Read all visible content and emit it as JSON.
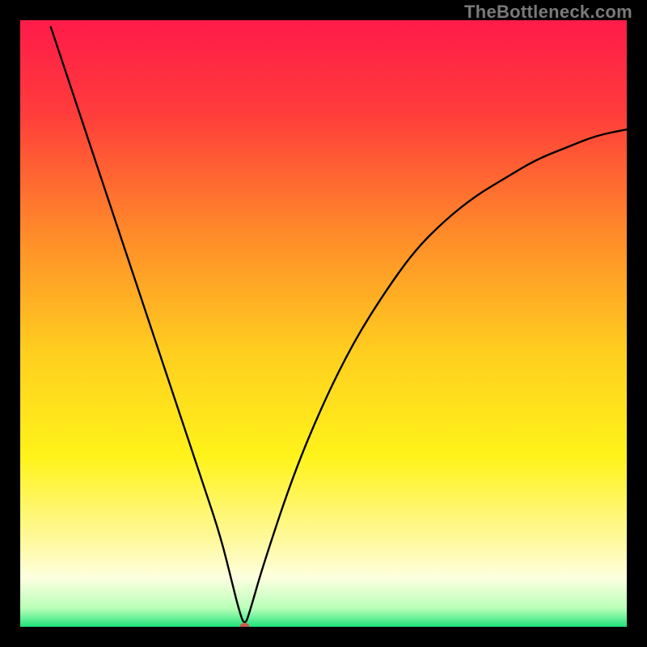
{
  "watermark": "TheBottleneck.com",
  "chart_data": {
    "type": "line",
    "title": "",
    "xlabel": "",
    "ylabel": "",
    "xlim": [
      0,
      100
    ],
    "ylim": [
      0,
      100
    ],
    "grid": false,
    "legend": false,
    "background_gradient": {
      "direction": "vertical",
      "stops": [
        {
          "pos": 0.0,
          "color": "#ff1b4a"
        },
        {
          "pos": 0.15,
          "color": "#ff3b3b"
        },
        {
          "pos": 0.35,
          "color": "#ff8a2a"
        },
        {
          "pos": 0.55,
          "color": "#ffcf1f"
        },
        {
          "pos": 0.72,
          "color": "#fff31a"
        },
        {
          "pos": 0.86,
          "color": "#fff9a0"
        },
        {
          "pos": 0.92,
          "color": "#fdffe0"
        },
        {
          "pos": 0.97,
          "color": "#b8ffb8"
        },
        {
          "pos": 1.0,
          "color": "#1fe27a"
        }
      ]
    },
    "series": [
      {
        "name": "bottleneck-curve",
        "color": "#000000",
        "x": [
          5,
          10,
          15,
          20,
          25,
          30,
          33,
          35,
          36,
          37,
          38,
          40,
          45,
          50,
          55,
          60,
          65,
          70,
          75,
          80,
          85,
          90,
          95,
          100
        ],
        "y": [
          99,
          84,
          69,
          54,
          39,
          24,
          15,
          7,
          3,
          0,
          3,
          10,
          25,
          37,
          47,
          55,
          62,
          67,
          71,
          74,
          77,
          79,
          81,
          82
        ]
      }
    ],
    "marker": {
      "name": "min-point",
      "x": 37,
      "y": 0,
      "color": "#cc5b52",
      "rx": 6,
      "ry": 5
    }
  }
}
